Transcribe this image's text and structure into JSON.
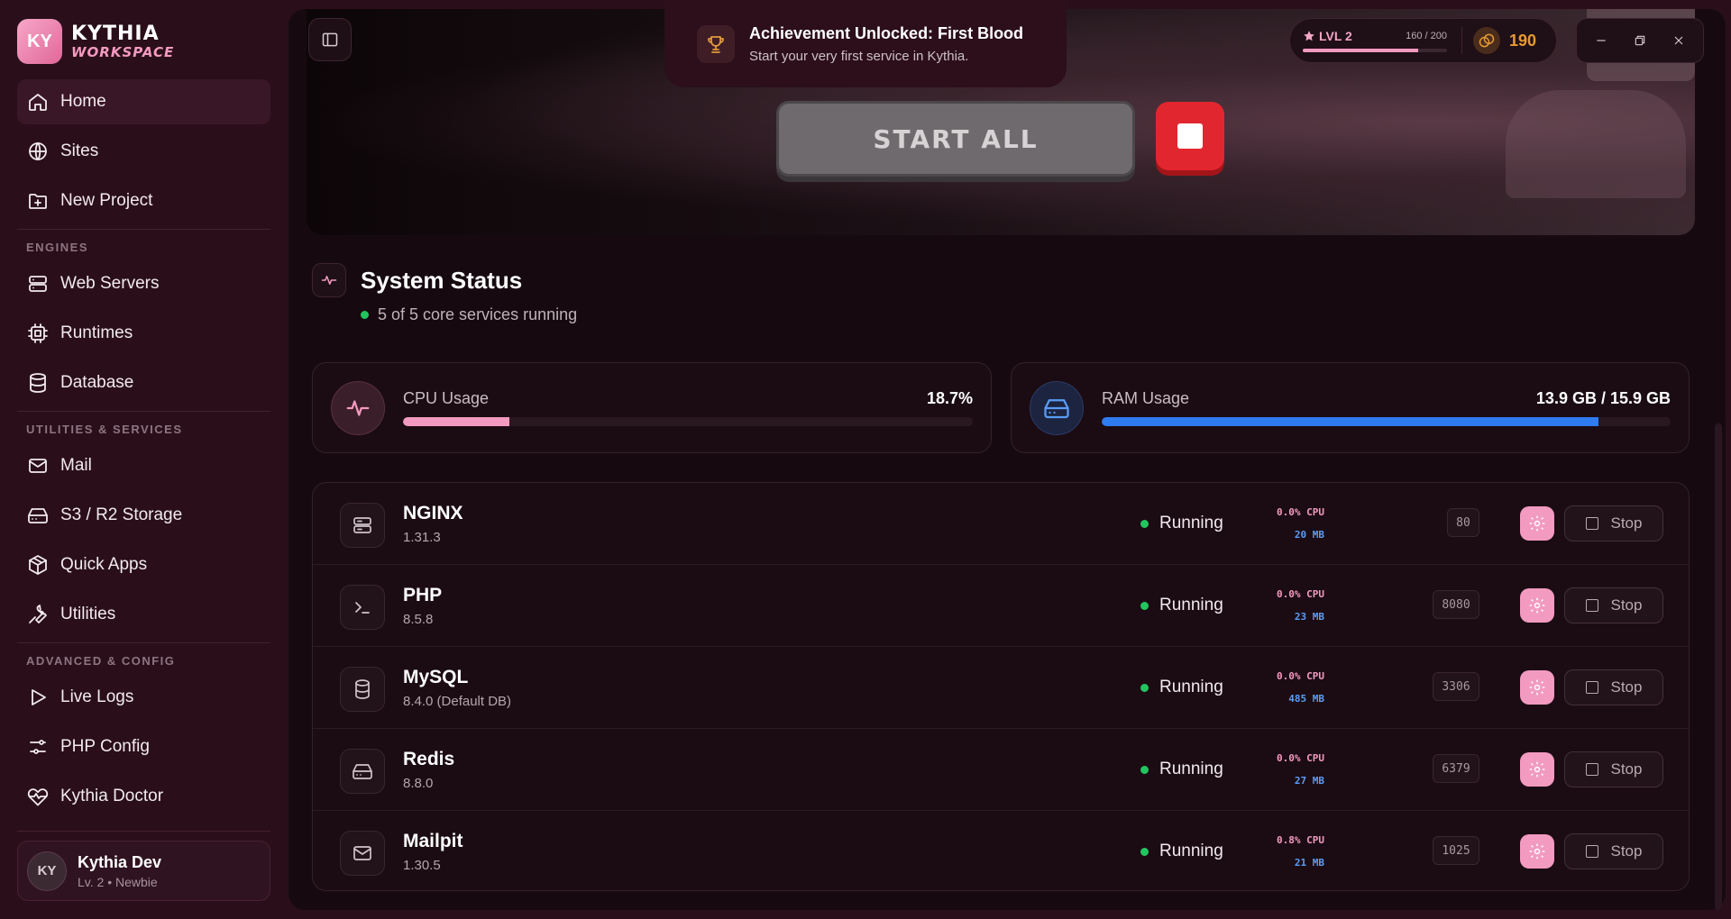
{
  "brand": {
    "logo_text": "KY",
    "line1": "KYTHIA",
    "line2": "WORKSPACE"
  },
  "sidebar": {
    "top_items": [
      {
        "label": "Home",
        "icon": "home-icon"
      },
      {
        "label": "Sites",
        "icon": "globe-icon"
      },
      {
        "label": "New Project",
        "icon": "folder-plus-icon"
      }
    ],
    "engines_label": "ENGINES",
    "engines": [
      {
        "label": "Web Servers",
        "icon": "server-icon"
      },
      {
        "label": "Runtimes",
        "icon": "cpu-icon"
      },
      {
        "label": "Database",
        "icon": "database-icon"
      }
    ],
    "utilities_label": "UTILITIES & SERVICES",
    "utilities": [
      {
        "label": "Mail",
        "icon": "mail-icon"
      },
      {
        "label": "S3 / R2 Storage",
        "icon": "hard-drive-icon"
      },
      {
        "label": "Quick Apps",
        "icon": "package-icon"
      },
      {
        "label": "Utilities",
        "icon": "wrench-icon"
      }
    ],
    "advanced_label": "ADVANCED & CONFIG",
    "advanced": [
      {
        "label": "Live Logs",
        "icon": "play-icon"
      },
      {
        "label": "PHP Config",
        "icon": "sliders-icon"
      },
      {
        "label": "Kythia Doctor",
        "icon": "heart-pulse-icon"
      }
    ],
    "user": {
      "initials": "KY",
      "name": "Kythia Dev",
      "subtitle": "Lv. 2 • Newbie"
    }
  },
  "toast": {
    "title": "Achievement Unlocked: First Blood",
    "message": "Start your very first service in Kythia.",
    "icon": "trophy-icon"
  },
  "level": {
    "label": "LVL 2",
    "xp_text": "160 / 200",
    "progress": 0.8,
    "coins": "190"
  },
  "hero": {
    "start_all": "START ALL"
  },
  "status": {
    "title": "System Status",
    "subtitle": "5 of 5 core services running",
    "cpu": {
      "label": "CPU Usage",
      "value": "18.7%",
      "fraction": 0.187,
      "color": "#f29ac0"
    },
    "ram": {
      "label": "RAM Usage",
      "value": "13.9 GB / 15.9 GB",
      "fraction": 0.874,
      "color": "#2f7bf0"
    }
  },
  "services": [
    {
      "name": "NGINX",
      "version": "1.31.3",
      "status": "Running",
      "cpu": "0.0% CPU",
      "mem": "20 MB",
      "port": "80",
      "icon": "server-icon",
      "stop": "Stop"
    },
    {
      "name": "PHP",
      "version": "8.5.8",
      "status": "Running",
      "cpu": "0.0% CPU",
      "mem": "23 MB",
      "port": "8080",
      "icon": "terminal-icon",
      "stop": "Stop"
    },
    {
      "name": "MySQL",
      "version": "8.4.0 (Default DB)",
      "status": "Running",
      "cpu": "0.0% CPU",
      "mem": "485 MB",
      "port": "3306",
      "icon": "database-icon",
      "stop": "Stop"
    },
    {
      "name": "Redis",
      "version": "8.8.0",
      "status": "Running",
      "cpu": "0.0% CPU",
      "mem": "27 MB",
      "port": "6379",
      "icon": "hard-drive-icon",
      "stop": "Stop"
    },
    {
      "name": "Mailpit",
      "version": "1.30.5",
      "status": "Running",
      "cpu": "0.8% CPU",
      "mem": "21 MB",
      "port": "1025",
      "icon": "mail-icon",
      "stop": "Stop"
    }
  ]
}
